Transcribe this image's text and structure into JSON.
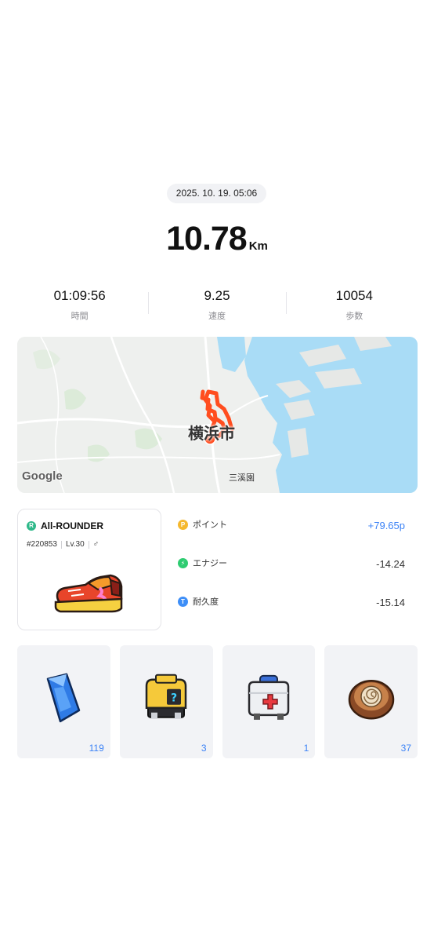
{
  "run": {
    "datetime": "2025. 10. 19. 05:06",
    "distance_value": "10.78",
    "distance_unit": "Km"
  },
  "stats": [
    {
      "value": "01:09:56",
      "label": "時間"
    },
    {
      "value": "9.25",
      "label": "速度"
    },
    {
      "value": "10054",
      "label": "歩数"
    }
  ],
  "map": {
    "city_label": "横浜市",
    "ward_label": "三溪園",
    "attribution": "Google",
    "route_color": "#ff4d1f",
    "water_color": "#a9dcf6"
  },
  "shoe": {
    "type_badge": "R",
    "name": "All-ROUNDER",
    "id": "#220853",
    "level": "Lv.30",
    "gender_symbol": "♂",
    "icon": "sneaker-icon"
  },
  "rewards": [
    {
      "icon_letter": "P",
      "icon": "point-icon",
      "color": "#f5b82e",
      "label": "ポイント",
      "value": "+79.65p",
      "positive": true
    },
    {
      "icon_letter": "⚡",
      "icon": "energy-icon",
      "color": "#2ecc71",
      "label": "エナジー",
      "value": "-14.24",
      "positive": false
    },
    {
      "icon_letter": "T",
      "icon": "durability-icon",
      "color": "#3d8ef7",
      "label": "耐久度",
      "value": "-15.14",
      "positive": false
    }
  ],
  "items": [
    {
      "icon": "blue-crystal-icon",
      "count": "119"
    },
    {
      "icon": "mystery-box-icon",
      "count": "3"
    },
    {
      "icon": "first-aid-kit-icon",
      "count": "1"
    },
    {
      "icon": "fossil-shell-icon",
      "count": "37"
    }
  ]
}
